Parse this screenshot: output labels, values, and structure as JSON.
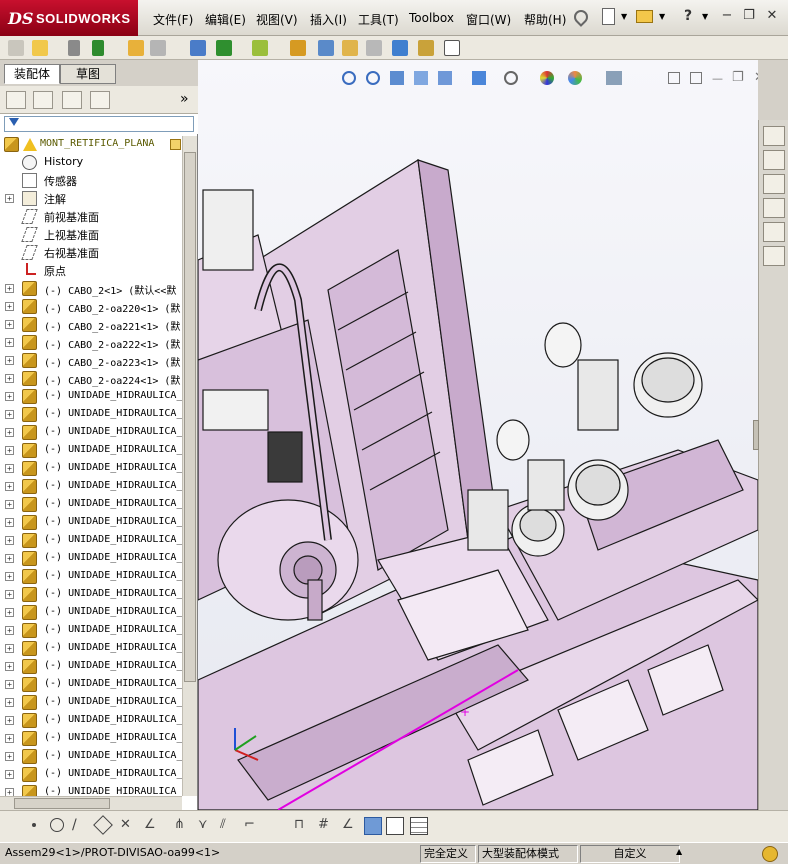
{
  "app": {
    "logo_ds": "DS",
    "logo_name": "SOLIDWORKS"
  },
  "menu": [
    {
      "label": "文件(F)"
    },
    {
      "label": "编辑(E)"
    },
    {
      "label": "视图(V)"
    },
    {
      "label": "插入(I)"
    },
    {
      "label": "工具(T)"
    },
    {
      "label": "Toolbox"
    },
    {
      "label": "窗口(W)"
    },
    {
      "label": "帮助(H)"
    }
  ],
  "panel": {
    "tabs": [
      {
        "label": "装配体"
      },
      {
        "label": "草图"
      }
    ],
    "collapse_glyph": "»",
    "tree": [
      {
        "label": "MONT_RETIFICA_PLANA",
        "kind": "root"
      },
      {
        "label": "History",
        "kind": "history"
      },
      {
        "label": "传感器",
        "kind": "sensor"
      },
      {
        "label": "注解",
        "kind": "annotation"
      },
      {
        "label": "前视基准面",
        "kind": "plane"
      },
      {
        "label": "上视基准面",
        "kind": "plane"
      },
      {
        "label": "右视基准面",
        "kind": "plane"
      },
      {
        "label": "原点",
        "kind": "origin"
      },
      {
        "label": "(-) CABO_2<1> (默认<<默",
        "kind": "part"
      },
      {
        "label": "(-) CABO_2-oa220<1> (默",
        "kind": "part"
      },
      {
        "label": "(-) CABO_2-oa221<1> (默",
        "kind": "part"
      },
      {
        "label": "(-) CABO_2-oa222<1> (默",
        "kind": "part"
      },
      {
        "label": "(-) CABO_2-oa223<1> (默",
        "kind": "part"
      },
      {
        "label": "(-) CABO_2-oa224<1> (默",
        "kind": "part"
      },
      {
        "label": "(-) UNIDADE_HIDRAULICA_",
        "kind": "part"
      },
      {
        "label": "(-) UNIDADE_HIDRAULICA_",
        "kind": "part"
      },
      {
        "label": "(-) UNIDADE_HIDRAULICA_",
        "kind": "part"
      },
      {
        "label": "(-) UNIDADE_HIDRAULICA_",
        "kind": "part"
      },
      {
        "label": "(-) UNIDADE_HIDRAULICA_",
        "kind": "part"
      },
      {
        "label": "(-) UNIDADE_HIDRAULICA_",
        "kind": "part"
      },
      {
        "label": "(-) UNIDADE_HIDRAULICA_",
        "kind": "part"
      },
      {
        "label": "(-) UNIDADE_HIDRAULICA_",
        "kind": "part"
      },
      {
        "label": "(-) UNIDADE_HIDRAULICA_",
        "kind": "part"
      },
      {
        "label": "(-) UNIDADE_HIDRAULICA_",
        "kind": "part"
      },
      {
        "label": "(-) UNIDADE_HIDRAULICA_",
        "kind": "part"
      },
      {
        "label": "(-) UNIDADE_HIDRAULICA_",
        "kind": "part"
      },
      {
        "label": "(-) UNIDADE_HIDRAULICA_",
        "kind": "part"
      },
      {
        "label": "(-) UNIDADE_HIDRAULICA_",
        "kind": "part"
      },
      {
        "label": "(-) UNIDADE_HIDRAULICA_",
        "kind": "part"
      },
      {
        "label": "(-) UNIDADE_HIDRAULICA_",
        "kind": "part"
      },
      {
        "label": "(-) UNIDADE_HIDRAULICA_",
        "kind": "part"
      },
      {
        "label": "(-) UNIDADE_HIDRAULICA_",
        "kind": "part"
      },
      {
        "label": "(-) UNIDADE_HIDRAULICA_",
        "kind": "part"
      },
      {
        "label": "(-) UNIDADE_HIDRAULICA_",
        "kind": "part"
      },
      {
        "label": "(-) UNIDADE_HIDRAULICA_",
        "kind": "part"
      },
      {
        "label": "(-) UNIDADE_HIDRAULICA_",
        "kind": "part"
      },
      {
        "label": "(-) UNIDADE_HIDRAULICA_",
        "kind": "part"
      },
      {
        "label": "(-) UNIDADE_HIDRAULICA",
        "kind": "part"
      }
    ]
  },
  "status": {
    "path": "Assem29<1>/PROT-DIVISAO-oa99<1>",
    "definition": "完全定义",
    "mode": "大型装配体模式",
    "units": "自定义",
    "caret": "▲"
  },
  "colors": {
    "model_fill": "#ddc6e0",
    "model_edge": "#1a1a1a",
    "logo_red": "#c8102e",
    "selection_line": "#e100e1"
  }
}
